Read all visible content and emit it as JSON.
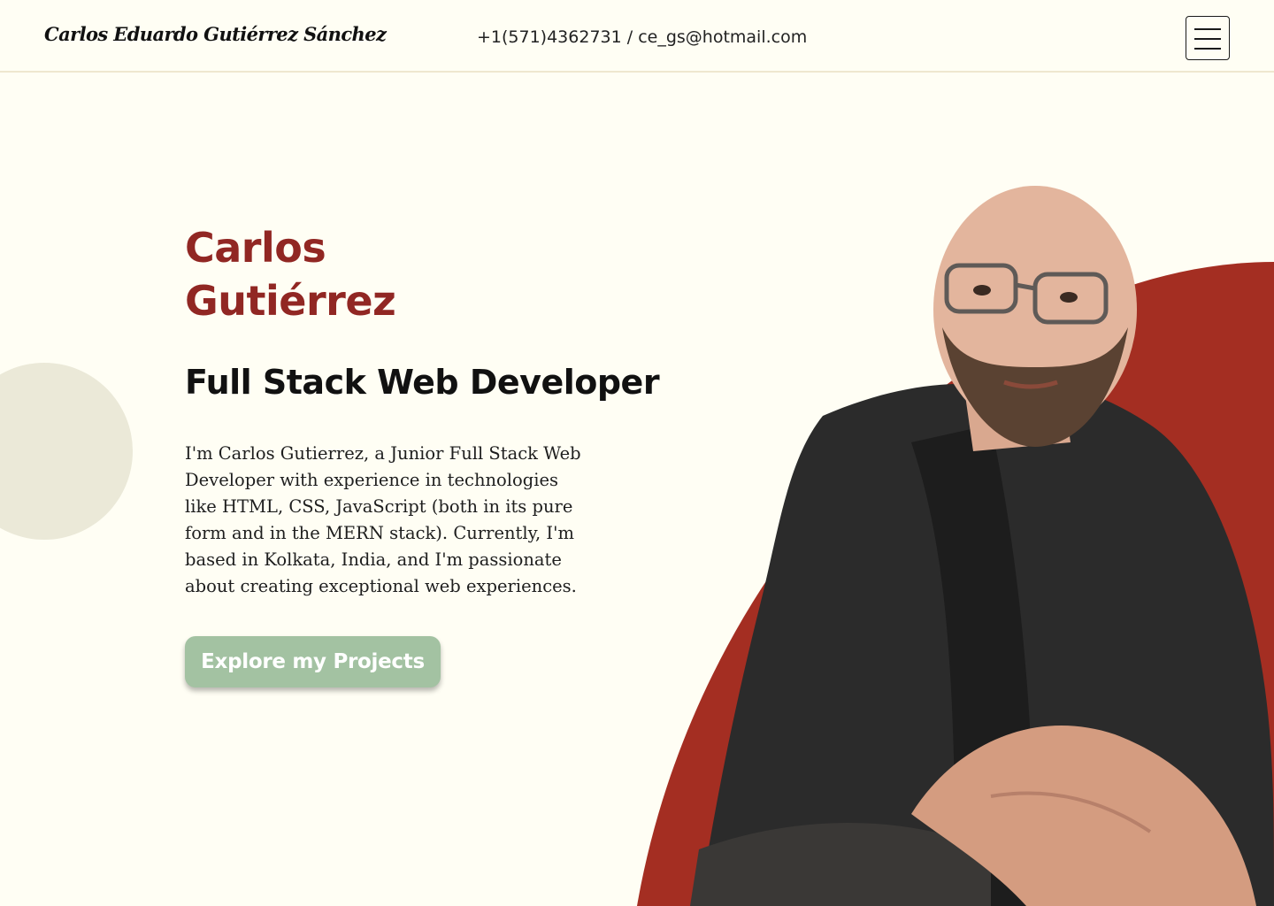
{
  "header": {
    "brand": "Carlos Eduardo Gutiérrez Sánchez",
    "contact": "+1(571)4362731 / ce_gs@hotmail.com",
    "menu_icon": "hamburger-menu-icon"
  },
  "hero": {
    "first_name": "Carlos",
    "last_name": "Gutiérrez",
    "role": "Full Stack Web Developer",
    "bio": "I'm Carlos Gutierrez, a Junior Full Stack Web Developer with experience in technologies like HTML, CSS, JavaScript (both in its pure form and in the MERN stack). Currently, I'm based in Kolkata, India, and I'm passionate about creating exceptional web experiences.",
    "cta_label": "Explore my Projects"
  },
  "colors": {
    "background": "#fffef4",
    "accent_red": "#a42e22",
    "name_red": "#912723",
    "cta_green": "#a3c2a2",
    "deco_beige": "#ebe9d8"
  }
}
